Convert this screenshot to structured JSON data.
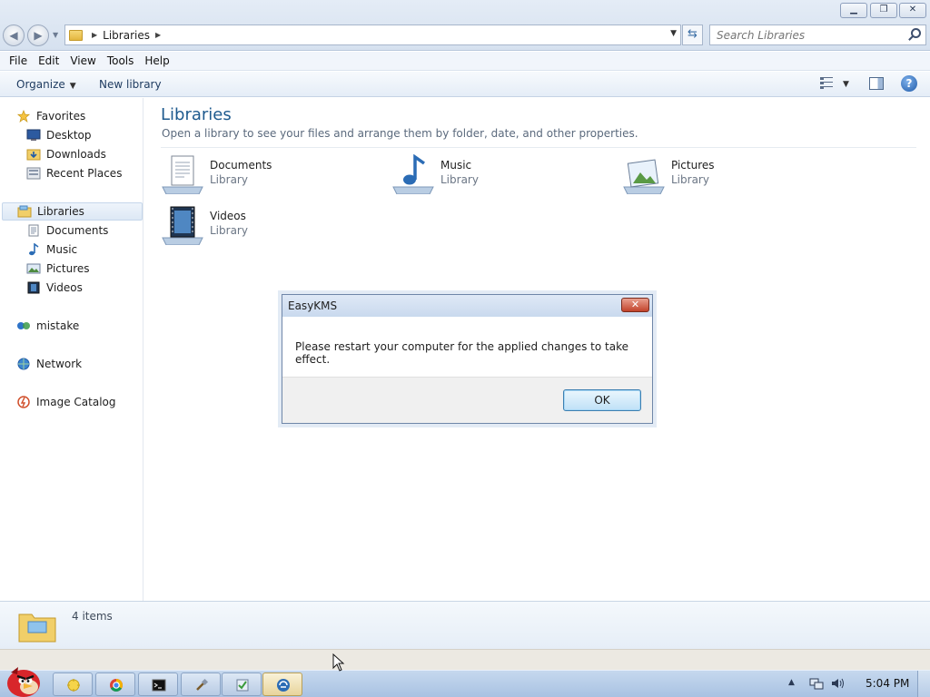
{
  "window": {
    "minimize_glyph": "▁",
    "maximize_glyph": "❐",
    "close_glyph": "✕"
  },
  "address": {
    "path": [
      "Libraries"
    ],
    "search_placeholder": "Search Libraries"
  },
  "menu": [
    "File",
    "Edit",
    "View",
    "Tools",
    "Help"
  ],
  "commands": {
    "organize": "Organize",
    "new_library": "New library"
  },
  "nav": {
    "favorites": {
      "label": "Favorites",
      "items": [
        "Desktop",
        "Downloads",
        "Recent Places"
      ]
    },
    "libraries": {
      "label": "Libraries",
      "items": [
        "Documents",
        "Music",
        "Pictures",
        "Videos"
      ]
    },
    "homegroup": "mistake",
    "network": "Network",
    "image_catalog": "Image Catalog"
  },
  "content": {
    "title": "Libraries",
    "subtitle": "Open a library to see your files and arrange them by folder, date, and other properties.",
    "libraries": [
      {
        "name": "Documents",
        "type": "Library",
        "icon": "documents-library-icon"
      },
      {
        "name": "Music",
        "type": "Library",
        "icon": "music-library-icon"
      },
      {
        "name": "Pictures",
        "type": "Library",
        "icon": "pictures-library-icon"
      },
      {
        "name": "Videos",
        "type": "Library",
        "icon": "videos-library-icon"
      }
    ]
  },
  "details": {
    "count": "4 items"
  },
  "dialog": {
    "title": "EasyKMS",
    "close_glyph": "✕",
    "message": "Please restart your computer for the applied changes to take effect.",
    "ok": "OK"
  },
  "taskbar": {
    "apps": [
      "explorer-icon",
      "chrome-icon",
      "cmd-icon",
      "tools-icon",
      "activation-icon",
      "easykms-icon"
    ],
    "active_app": "easykms-icon",
    "clock": "5:04 PM"
  },
  "colors": {
    "accent_title": "#1e5a8e",
    "dialog_close": "#c2432b",
    "taskbar": "#b8cbe4"
  }
}
